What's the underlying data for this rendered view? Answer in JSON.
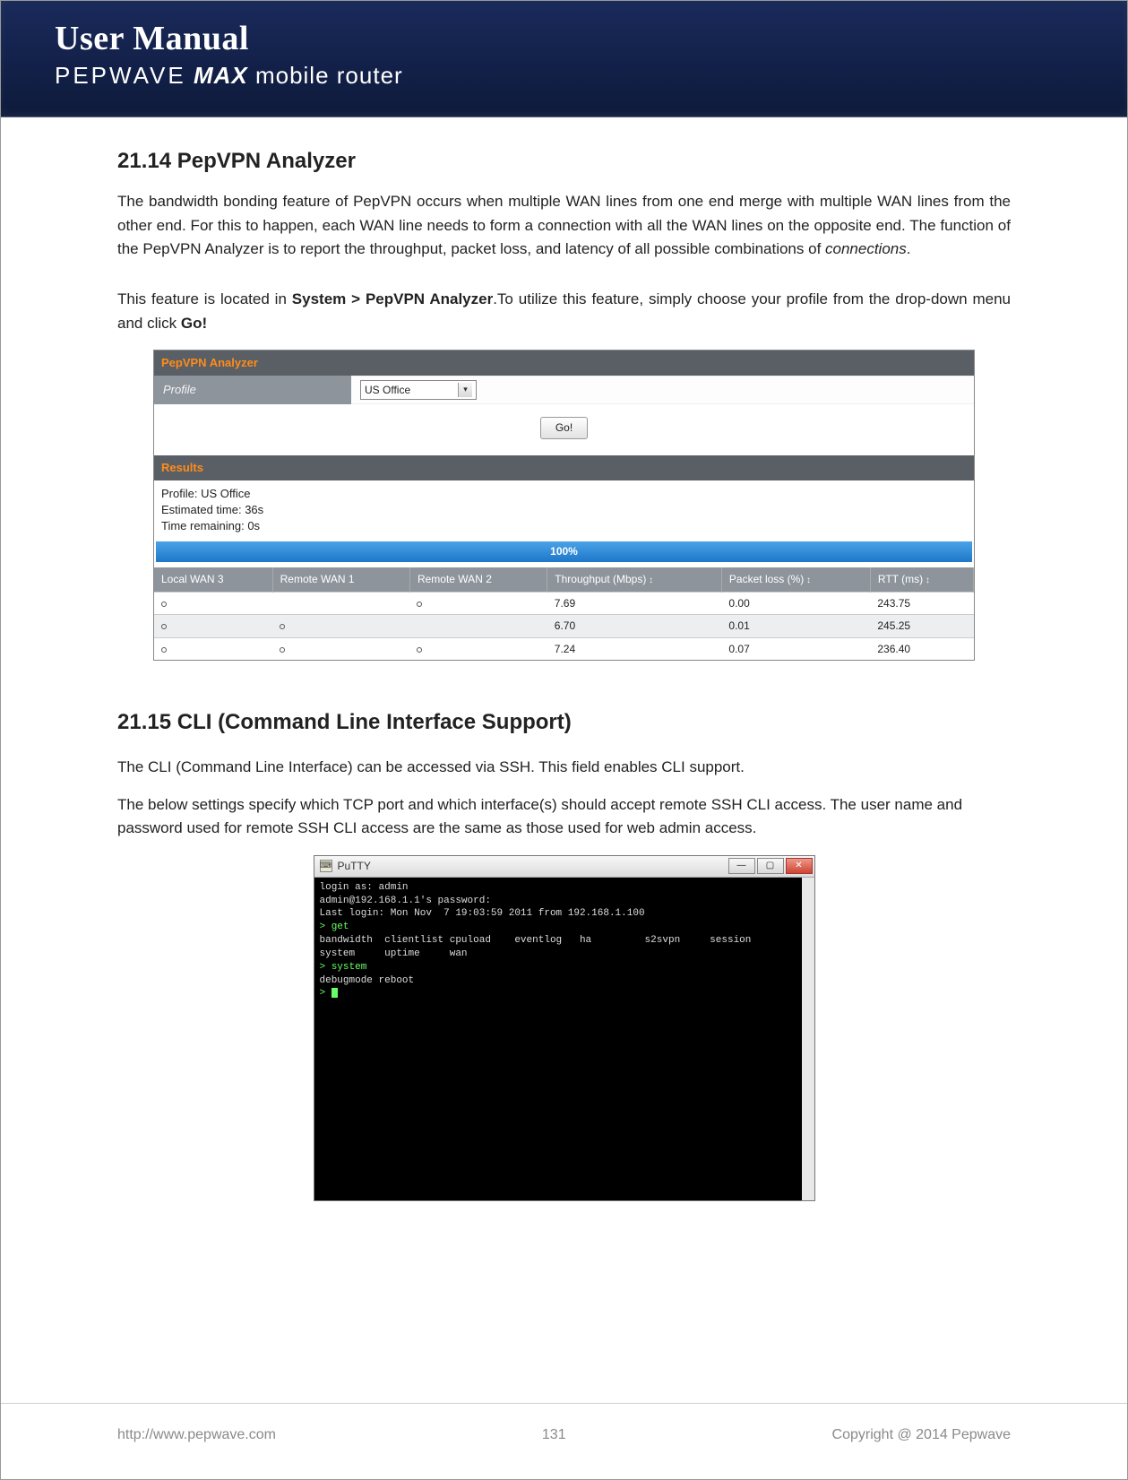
{
  "header": {
    "title": "User Manual",
    "brand": "PEPWAVE",
    "product": "MAX",
    "rest": "mobile router"
  },
  "section1": {
    "num": "21.14",
    "title": "PepVPN Analyzer",
    "p1a": "The bandwidth bonding feature of PepVPN occurs when multiple WAN lines from one end merge with multiple WAN lines from the other end. For this to happen, each WAN line needs to form a connection with all the WAN lines on the opposite end. The function of the PepVPN Analyzer is to report the throughput, packet loss, and latency of all possible combinations of ",
    "p1_term": "connections",
    "p1b": ".",
    "p2a": "This feature is located in ",
    "p2_bold": "System > PepVPN Analyzer",
    "p2b": ".To utilize this feature, simply choose your profile from the drop-down menu and click ",
    "p2_bold2": "Go!"
  },
  "analyzer": {
    "panel_title": "PepVPN Analyzer",
    "profile_label": "Profile",
    "profile_value": "US Office",
    "go_label": "Go!",
    "results_title": "Results",
    "status_profile": "Profile: US Office",
    "status_eta": "Estimated time: 36s",
    "status_remain": "Time remaining: 0s",
    "progress": "100%",
    "cols": [
      "Local WAN 3",
      "Remote WAN 1",
      "Remote WAN 2",
      "Throughput (Mbps)",
      "Packet loss (%)",
      "RTT (ms)"
    ],
    "rows": [
      {
        "l3": true,
        "r1": false,
        "r2": true,
        "thr": "7.69",
        "loss": "0.00",
        "rtt": "243.75"
      },
      {
        "l3": true,
        "r1": true,
        "r2": false,
        "thr": "6.70",
        "loss": "0.01",
        "rtt": "245.25"
      },
      {
        "l3": true,
        "r1": true,
        "r2": true,
        "thr": "7.24",
        "loss": "0.07",
        "rtt": "236.40"
      }
    ]
  },
  "section2": {
    "num": "21.15",
    "title": "CLI (Command Line Interface Support)",
    "p1": "The CLI (Command Line Interface) can be accessed via SSH. This field enables CLI support.",
    "p2": "The below settings specify which TCP port and which interface(s) should accept remote SSH CLI access. The user name and password used for remote SSH CLI access are the same as those used for web admin access."
  },
  "putty": {
    "title": "PuTTY",
    "lines": [
      "login as: admin",
      "admin@192.168.1.1's password:",
      "Last login: Mon Nov  7 19:03:59 2011 from 192.168.1.100",
      "> get",
      "bandwidth  clientlist cpuload    eventlog   ha         s2svpn     session",
      "system     uptime     wan",
      "> system",
      "debugmode reboot",
      ">"
    ]
  },
  "footer": {
    "url": "http://www.pepwave.com",
    "page": "131",
    "copyright": "Copyright @ 2014 Pepwave"
  }
}
